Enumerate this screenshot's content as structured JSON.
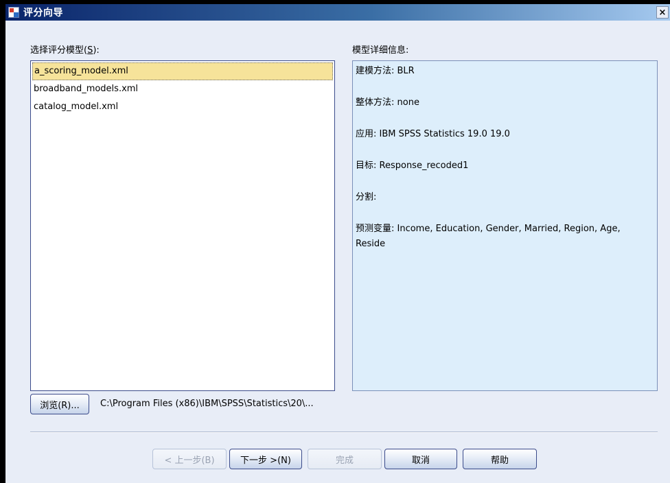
{
  "window": {
    "title": "评分向导",
    "close_label": "×"
  },
  "left_panel": {
    "label": "选择评分模型(",
    "label_accel": "S",
    "label_end": "):",
    "items": [
      "a_scoring_model.xml",
      "broadband_models.xml",
      "catalog_model.xml"
    ],
    "selected_index": 0
  },
  "right_panel": {
    "label": "模型详细信息:",
    "details": [
      "建模方法: BLR",
      "整体方法: none",
      "应用: IBM SPSS Statistics 19.0 19.0",
      "目标: Response_recoded1",
      "分割:",
      "预测变量: Income, Education, Gender, Married, Region, Age,",
      "Reside"
    ]
  },
  "browse": {
    "label": "浏览(R)...",
    "path": "C:\\Program Files (x86)\\IBM\\SPSS\\Statistics\\20\\..."
  },
  "buttons": {
    "back": "< 上一步(B)",
    "next": "下一步 >(N)",
    "finish": "完成",
    "cancel": "取消",
    "help": "帮助"
  }
}
